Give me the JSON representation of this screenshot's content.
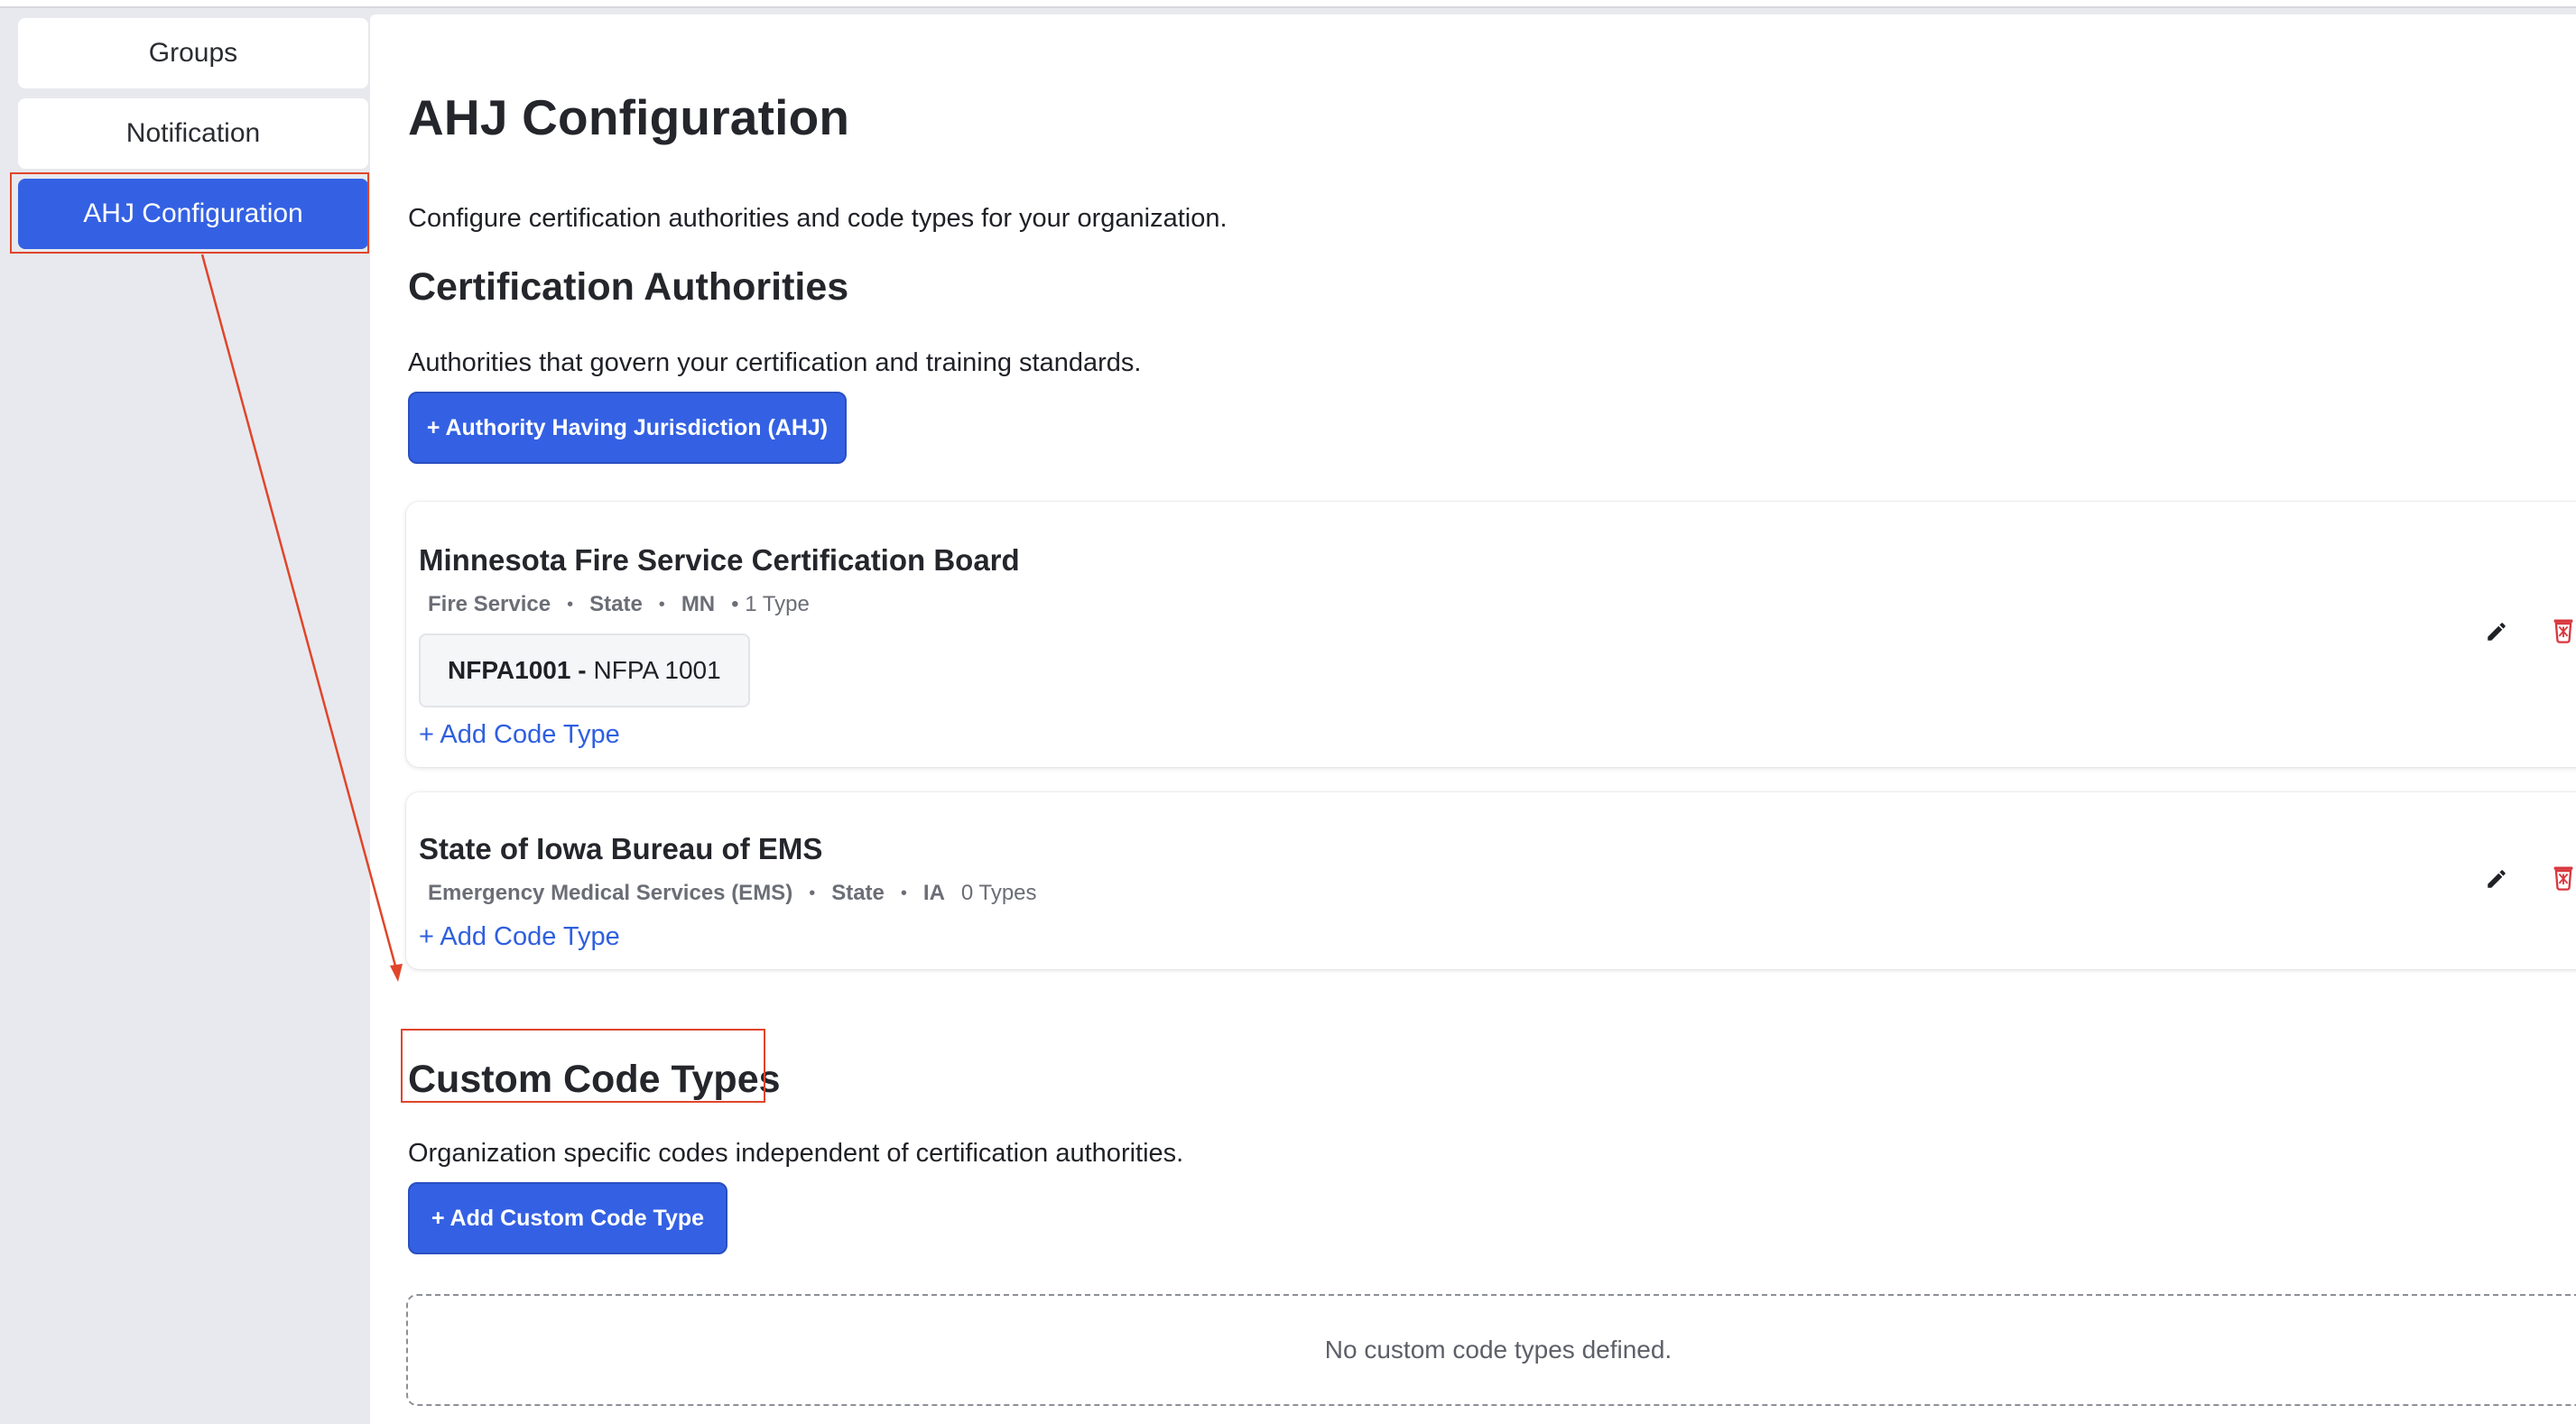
{
  "sidebar": {
    "items": [
      {
        "label": "Groups",
        "active": false
      },
      {
        "label": "Notification",
        "active": false
      },
      {
        "label": "AHJ Configuration",
        "active": true
      }
    ]
  },
  "main": {
    "title": "AHJ Configuration",
    "description": "Configure certification authorities and code types for your organization.",
    "certification": {
      "heading": "Certification Authorities",
      "description": "Authorities that govern your certification and training standards.",
      "add_button": "+ Authority Having Jurisdiction (AHJ)",
      "authorities": [
        {
          "name": "Minnesota Fire Service Certification Board",
          "category": "Fire Service",
          "level": "State",
          "state": "MN",
          "type_count": "• 1 Type",
          "code_types": [
            {
              "code": "NFPA1001 -",
              "name": "NFPA 1001"
            }
          ],
          "add_code_label": "+ Add Code Type"
        },
        {
          "name": "State of Iowa Bureau of EMS",
          "category": "Emergency Medical Services (EMS)",
          "level": "State",
          "state": "IA",
          "type_count": "0 Types",
          "code_types": [],
          "add_code_label": "+ Add Code Type"
        }
      ]
    },
    "custom": {
      "heading": "Custom Code Types",
      "description": "Organization specific codes independent of certification authorities.",
      "add_button": "+ Add Custom Code Type",
      "empty_text": "No custom code types defined."
    }
  },
  "icons": {
    "edit": "pencil-icon",
    "delete": "trash-icon"
  },
  "colors": {
    "accent": "#3461e3",
    "link": "#2f5fe0",
    "delete": "#d9363e",
    "annotation": "#e0452a"
  }
}
